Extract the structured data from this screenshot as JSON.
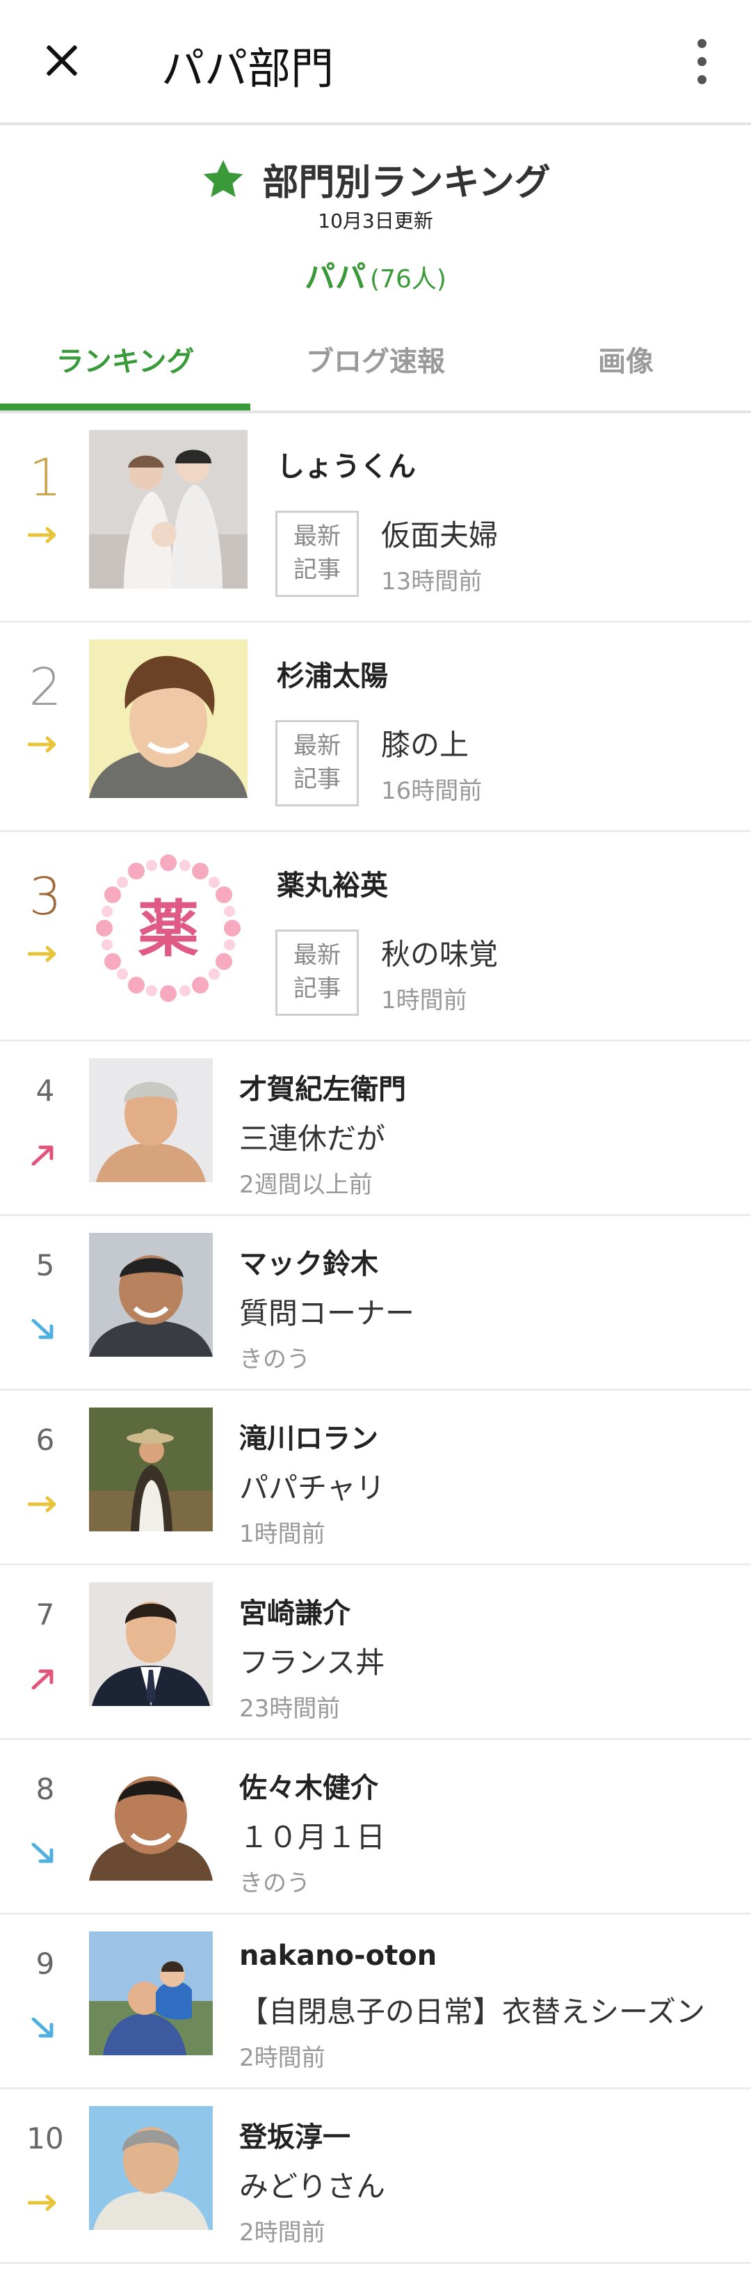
{
  "appbar": {
    "title": "パパ部門",
    "close_icon": "close-icon",
    "more_icon": "more-vertical-icon"
  },
  "ranking_header": {
    "title": "部門別ランキング",
    "updated": "10月3日更新",
    "category_name": "パパ",
    "category_count": "(76人)",
    "star_icon": "star-icon",
    "accent_color": "#3a9a3a"
  },
  "tabs": [
    {
      "label": "ランキング",
      "active": true
    },
    {
      "label": "ブログ速報",
      "active": false
    },
    {
      "label": "画像",
      "active": false
    }
  ],
  "latest_badge": {
    "line1": "最新",
    "line2": "記事"
  },
  "entries": [
    {
      "rank": "1",
      "trend": "flat",
      "name": "しょうくん",
      "post": "仮面夫婦",
      "time": "13時間前",
      "thumb": "couple-photo"
    },
    {
      "rank": "2",
      "trend": "flat",
      "name": "杉浦太陽",
      "post": "膝の上",
      "time": "16時間前",
      "thumb": "man-portrait"
    },
    {
      "rank": "3",
      "trend": "flat",
      "name": "薬丸裕英",
      "post": "秋の味覚",
      "time": "1時間前",
      "thumb": "kanji-logo",
      "logo_text": "薬"
    },
    {
      "rank": "4",
      "trend": "up",
      "name": "才賀紀左衛門",
      "post": "三連休だが",
      "time": "2週間以上前",
      "thumb": "man-portrait"
    },
    {
      "rank": "5",
      "trend": "down",
      "name": "マック鈴木",
      "post": "質問コーナー",
      "time": "きのう",
      "thumb": "man-portrait"
    },
    {
      "rank": "6",
      "trend": "flat",
      "name": "滝川ロラン",
      "post": "パパチャリ",
      "time": "1時間前",
      "thumb": "man-portrait"
    },
    {
      "rank": "7",
      "trend": "up",
      "name": "宮崎謙介",
      "post": "フランス丼",
      "time": "23時間前",
      "thumb": "man-portrait"
    },
    {
      "rank": "8",
      "trend": "down",
      "name": "佐々木健介",
      "post": "１０月１日",
      "time": "きのう",
      "thumb": "man-portrait"
    },
    {
      "rank": "9",
      "trend": "down",
      "name": "nakano-oton",
      "post": "【自閉息子の日常】衣替えシーズン",
      "time": "2時間前",
      "thumb": "father-child-photo"
    },
    {
      "rank": "10",
      "trend": "flat",
      "name": "登坂淳一",
      "post": "みどりさん",
      "time": "2時間前",
      "thumb": "man-portrait"
    }
  ],
  "colors": {
    "trend_flat": "#e8c43a",
    "trend_up": "#e2557a",
    "trend_down": "#4fb0e0",
    "gold": "#c9a44b",
    "silver": "#9a9a9a",
    "bronze": "#a06a38"
  }
}
